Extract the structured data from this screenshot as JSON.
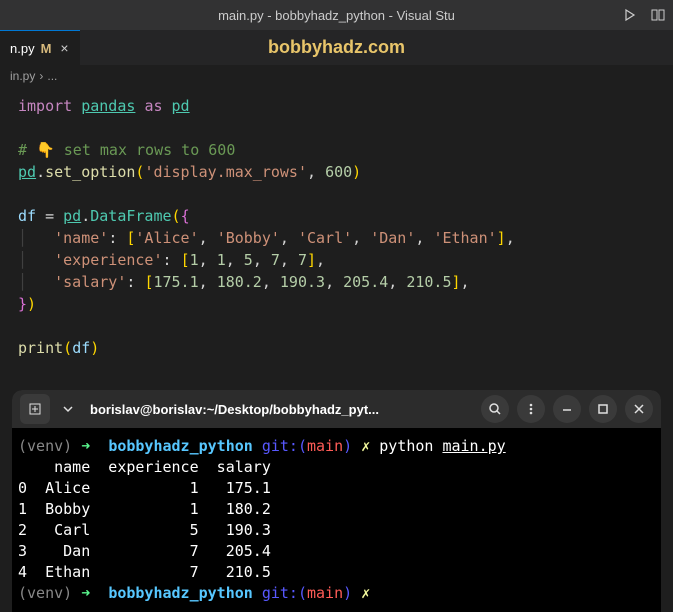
{
  "titlebar": {
    "title": "main.py - bobbyhadz_python - Visual Stu"
  },
  "tab": {
    "name": "n.py",
    "modified": "M"
  },
  "brand": "bobbyhadz.com",
  "breadcrumb": {
    "file": "in.py",
    "sep": "›",
    "more": "..."
  },
  "code": {
    "l1_import": "import",
    "l1_pandas": "pandas",
    "l1_as": "as",
    "l1_pd": "pd",
    "l3_comment": "# 👇 set max rows to 600",
    "l4_pd": "pd",
    "l4_fn": "set_option",
    "l4_arg1": "'display.max_rows'",
    "l4_arg2": "600",
    "l6_df": "df",
    "l6_pd": "pd",
    "l6_dataframe": "DataFrame",
    "l7_key": "'name'",
    "l7_v1": "'Alice'",
    "l7_v2": "'Bobby'",
    "l7_v3": "'Carl'",
    "l7_v4": "'Dan'",
    "l7_v5": "'Ethan'",
    "l8_key": "'experience'",
    "l8_v1": "1",
    "l8_v2": "1",
    "l8_v3": "5",
    "l8_v4": "7",
    "l8_v5": "7",
    "l9_key": "'salary'",
    "l9_v1": "175.1",
    "l9_v2": "180.2",
    "l9_v3": "190.3",
    "l9_v4": "205.4",
    "l9_v5": "210.5",
    "l12_print": "print",
    "l12_arg": "df"
  },
  "terminal": {
    "title": "borislav@borislav:~/Desktop/bobbyhadz_pyt...",
    "prompt": {
      "venv": "(venv)",
      "arrow": "➜",
      "dir": "bobbyhadz_python",
      "git": "git:(",
      "branch": "main",
      "gitclose": ")",
      "dirty": "✗"
    },
    "cmd": {
      "python": "python",
      "file": "main.py"
    },
    "output": {
      "header": "    name  experience  salary",
      "rows": [
        "0  Alice           1   175.1",
        "1  Bobby           1   180.2",
        "2   Carl           5   190.3",
        "3    Dan           7   205.4",
        "4  Ethan           7   210.5"
      ]
    }
  }
}
